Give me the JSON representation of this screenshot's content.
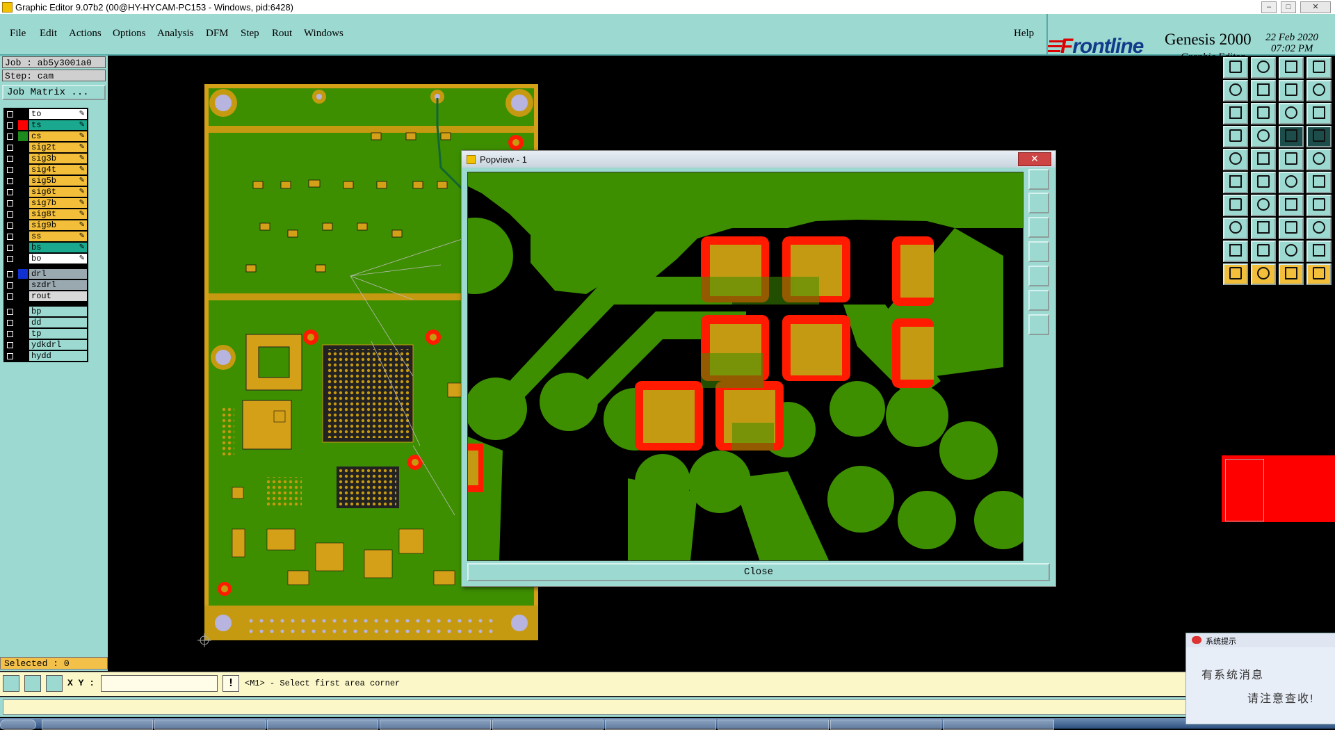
{
  "window": {
    "title": "Graphic Editor 9.07b2 (00@HY-HYCAM-PC153 - Windows, pid:6428)",
    "buttons": [
      "minimize-icon",
      "maximize-icon",
      "close-icon"
    ]
  },
  "menu": {
    "items": [
      "File",
      "Edit",
      "Actions",
      "Options",
      "Analysis",
      "DFM",
      "Step",
      "Rout",
      "Windows"
    ],
    "help": "Help"
  },
  "branding": {
    "logo": "Frontline",
    "product": "Genesis 2000",
    "subtitle": "Graphic Editor",
    "date": "22 Feb 2020",
    "time": "07:02 PM"
  },
  "job": {
    "job": "Job : ab5y3001a0",
    "step": "Step: cam",
    "matrix_button": "Job Matrix ..."
  },
  "layers": {
    "group1": [
      {
        "name": "to",
        "color": "#000000",
        "bg": "#ffffff"
      },
      {
        "name": "ts",
        "color": "#ff0000",
        "bg": "#1aa88e"
      },
      {
        "name": "cs",
        "color": "#1e8a1e",
        "bg": "#f3bf3a",
        "active": true
      },
      {
        "name": "sig2t",
        "color": "#000000",
        "bg": "#f3bf3a"
      },
      {
        "name": "sig3b",
        "color": "#000000",
        "bg": "#f3bf3a"
      },
      {
        "name": "sig4t",
        "color": "#000000",
        "bg": "#f3bf3a"
      },
      {
        "name": "sig5b",
        "color": "#000000",
        "bg": "#f3bf3a"
      },
      {
        "name": "sig6t",
        "color": "#000000",
        "bg": "#f3bf3a"
      },
      {
        "name": "sig7b",
        "color": "#000000",
        "bg": "#f3bf3a"
      },
      {
        "name": "sig8t",
        "color": "#000000",
        "bg": "#f3bf3a"
      },
      {
        "name": "sig9b",
        "color": "#000000",
        "bg": "#f3bf3a"
      },
      {
        "name": "ss",
        "color": "#000000",
        "bg": "#f3bf3a"
      },
      {
        "name": "bs",
        "color": "#000000",
        "bg": "#1aa88e"
      },
      {
        "name": "bo",
        "color": "#000000",
        "bg": "#ffffff"
      }
    ],
    "group2": [
      {
        "name": "drl",
        "color": "#1030d0",
        "bg": "#9aa8b0"
      },
      {
        "name": "szdrl",
        "color": "#000000",
        "bg": "#9aa8b0"
      },
      {
        "name": "rout",
        "color": "#000000",
        "bg": "#d9d9d9"
      }
    ],
    "group3": [
      {
        "name": "bp",
        "color": "#000000",
        "bg": "#9cd9d1"
      },
      {
        "name": "dd",
        "color": "#000000",
        "bg": "#9cd9d1"
      },
      {
        "name": "tp",
        "color": "#000000",
        "bg": "#9cd9d1"
      },
      {
        "name": "ydkdrl",
        "color": "#000000",
        "bg": "#9cd9d1"
      },
      {
        "name": "hydd",
        "color": "#000000",
        "bg": "#9cd9d1"
      }
    ]
  },
  "selected": "Selected : 0",
  "popview": {
    "title": "Popview - 1",
    "close": "Close",
    "tools": [
      "zoom-fit-icon",
      "zoom-in-icon",
      "zoom-out-icon",
      "pan-left-icon",
      "pan-right-icon",
      "fit-all-icon",
      "center-icon"
    ]
  },
  "command": {
    "xy_label": "X Y :",
    "xy_value": "",
    "prompt": "<M1> - Select first area corner"
  },
  "notification": {
    "title": "系统提示",
    "line1": "有系统消息",
    "line2": "请注意查收!"
  },
  "colors": {
    "panel": "#9cd9d1",
    "board_green": "#3d8f00",
    "copper": "#c69a10",
    "pad_red": "#ff1a00"
  }
}
